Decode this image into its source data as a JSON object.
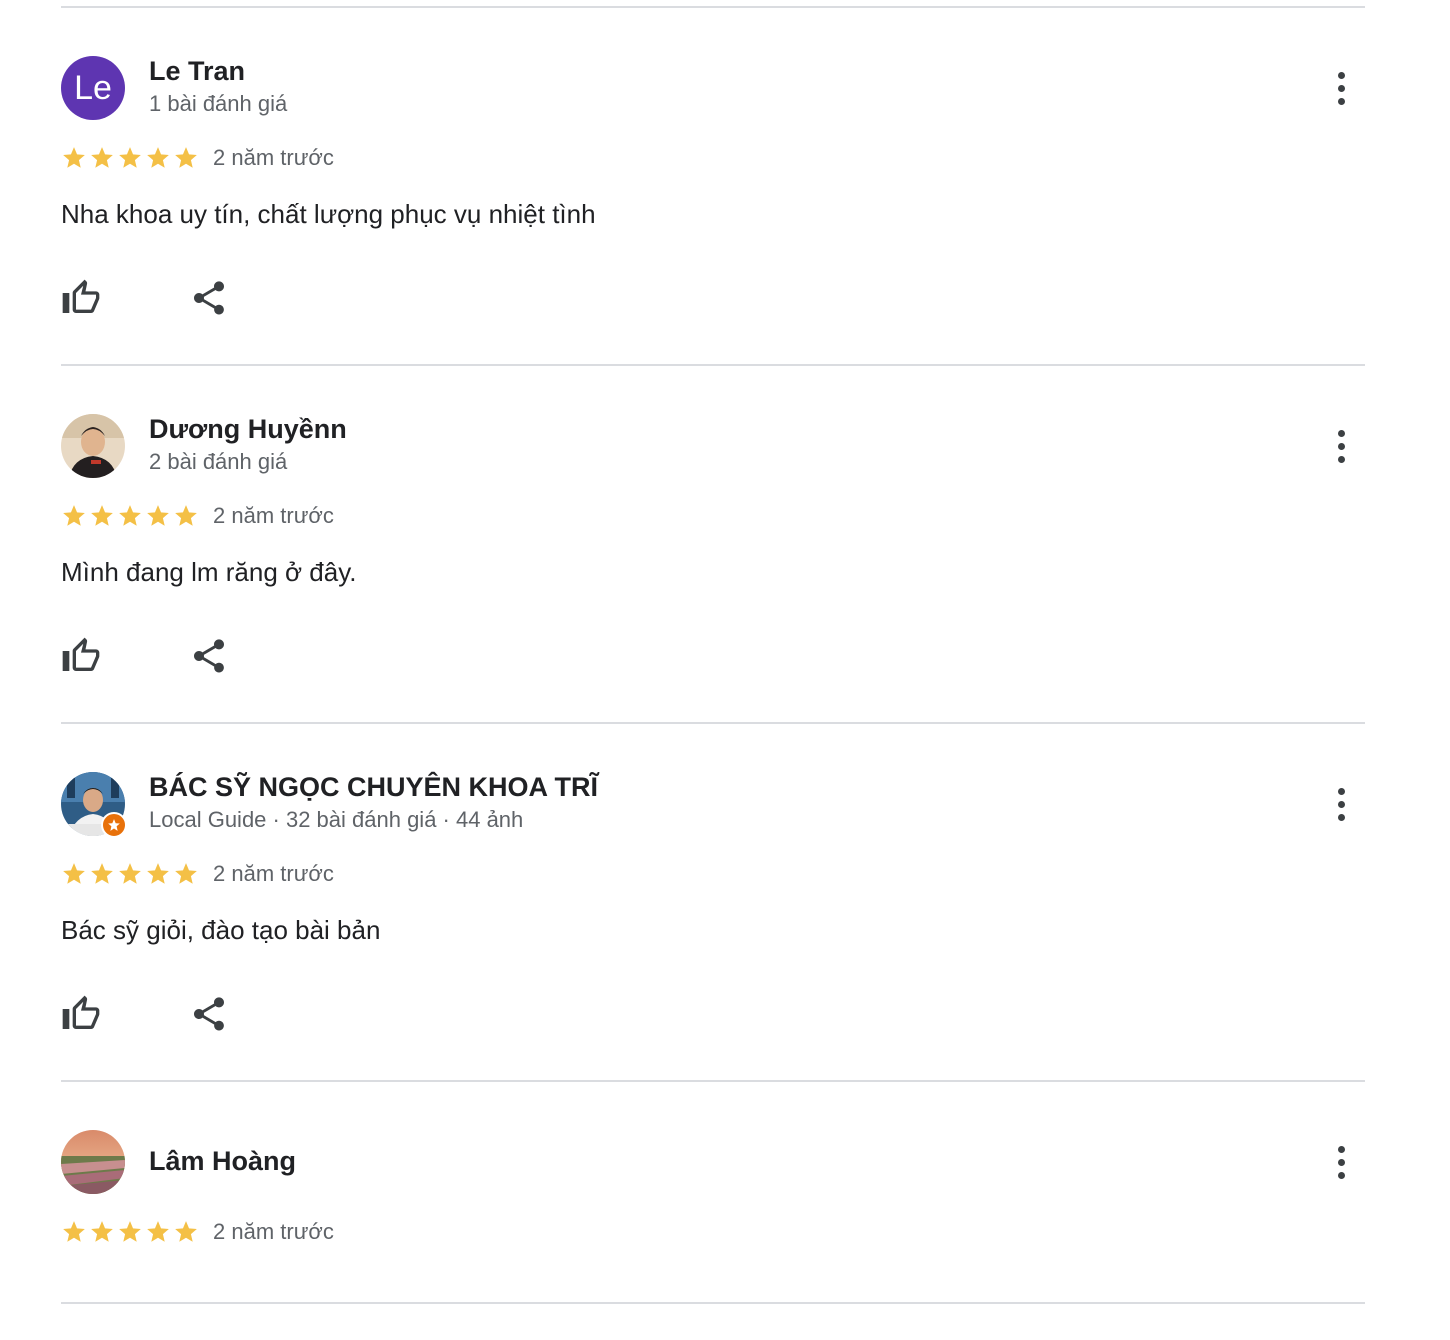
{
  "colors": {
    "star": "#f4c046",
    "avatar_le": "#5e35b1",
    "divider": "#dadce0",
    "text_primary": "#202124",
    "text_secondary": "#5f6368",
    "local_guide_badge": "#e8710a"
  },
  "icons": {
    "like": "thumb-up-outline-icon",
    "share": "share-icon",
    "more": "more-vert-icon",
    "star": "star-icon"
  },
  "reviews": [
    {
      "avatar_letters": "Le",
      "name": "Le Tran",
      "meta": "1 bài đánh giá",
      "rating": 5,
      "time": "2 năm trước",
      "text": "Nha khoa uy tín, chất lượng phục vụ nhiệt tình"
    },
    {
      "name": "Dương Huyềnn",
      "meta": "2 bài đánh giá",
      "rating": 5,
      "time": "2 năm trước",
      "text": "Mình đang lm răng ở đây."
    },
    {
      "name": "BÁC SỸ NGỌC CHUYÊN KHOA TRĨ",
      "meta": "Local Guide · 32 bài đánh giá · 44 ảnh",
      "rating": 5,
      "time": "2 năm trước",
      "text": "Bác sỹ giỏi, đào tạo bài bản"
    },
    {
      "name": "Lâm Hoàng",
      "rating": 5,
      "time": "2 năm trước"
    }
  ]
}
